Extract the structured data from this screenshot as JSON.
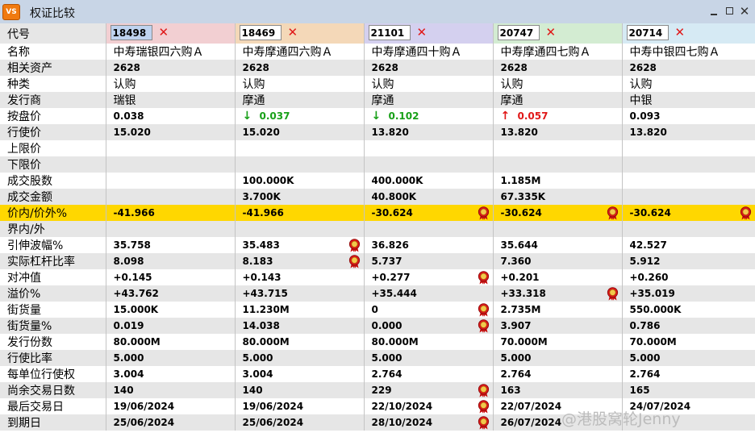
{
  "window": {
    "icon_text": "VS",
    "title": "权证比较",
    "minimize_icon": "minimize-icon",
    "maximize_icon": "maximize-icon",
    "close_icon": "close-icon",
    "close_glyph": "✕"
  },
  "colors": {
    "highlight_row": "#ffd700",
    "up": "#e01818",
    "down": "#18a018",
    "remove": "#e01818",
    "column_headers": [
      "#f2cfd2",
      "#f4d8b8",
      "#d4d0ef",
      "#d3ecd2",
      "#d6eaf4"
    ]
  },
  "header": {
    "code_label": "代号",
    "remove_glyph": "✕",
    "codes": [
      "18498",
      "18469",
      "21101",
      "20747",
      "20714"
    ]
  },
  "rows": [
    {
      "label": "名称",
      "type": "cjk",
      "cells": [
        {
          "v": "中寿瑞银四六购Ａ"
        },
        {
          "v": "中寿摩通四六购Ａ"
        },
        {
          "v": "中寿摩通四十购Ａ"
        },
        {
          "v": "中寿摩通四七购Ａ"
        },
        {
          "v": "中寿中银四七购Ａ"
        }
      ]
    },
    {
      "label": "相关资产",
      "type": "num",
      "cells": [
        {
          "v": "2628"
        },
        {
          "v": "2628"
        },
        {
          "v": "2628"
        },
        {
          "v": "2628"
        },
        {
          "v": "2628"
        }
      ]
    },
    {
      "label": "种类",
      "type": "cjk",
      "cells": [
        {
          "v": "认购"
        },
        {
          "v": "认购"
        },
        {
          "v": "认购"
        },
        {
          "v": "认购"
        },
        {
          "v": "认购"
        }
      ]
    },
    {
      "label": "发行商",
      "type": "cjk",
      "cells": [
        {
          "v": "瑞银"
        },
        {
          "v": "摩通"
        },
        {
          "v": "摩通"
        },
        {
          "v": "摩通"
        },
        {
          "v": "中银"
        }
      ]
    },
    {
      "label": "按盘价",
      "type": "num",
      "cells": [
        {
          "v": "0.038"
        },
        {
          "v": "0.037",
          "dir": "down"
        },
        {
          "v": "0.102",
          "dir": "down"
        },
        {
          "v": "0.057",
          "dir": "up"
        },
        {
          "v": "0.093"
        }
      ]
    },
    {
      "label": "行使价",
      "type": "num",
      "cells": [
        {
          "v": "15.020"
        },
        {
          "v": "15.020"
        },
        {
          "v": "13.820"
        },
        {
          "v": "13.820"
        },
        {
          "v": "13.820"
        }
      ]
    },
    {
      "label": "上限价",
      "type": "num",
      "cells": [
        {
          "v": ""
        },
        {
          "v": ""
        },
        {
          "v": ""
        },
        {
          "v": ""
        },
        {
          "v": ""
        }
      ]
    },
    {
      "label": "下限价",
      "type": "num",
      "cells": [
        {
          "v": ""
        },
        {
          "v": ""
        },
        {
          "v": ""
        },
        {
          "v": ""
        },
        {
          "v": ""
        }
      ]
    },
    {
      "label": "成交股数",
      "type": "num",
      "cells": [
        {
          "v": ""
        },
        {
          "v": "100.000K"
        },
        {
          "v": "400.000K"
        },
        {
          "v": "1.185M"
        },
        {
          "v": ""
        }
      ]
    },
    {
      "label": "成交金额",
      "type": "num",
      "cells": [
        {
          "v": ""
        },
        {
          "v": "3.700K"
        },
        {
          "v": "40.800K"
        },
        {
          "v": "67.335K"
        },
        {
          "v": ""
        }
      ]
    },
    {
      "label": "价内/价外%",
      "type": "num",
      "highlight": true,
      "cells": [
        {
          "v": "-41.966"
        },
        {
          "v": "-41.966"
        },
        {
          "v": "-30.624",
          "best": true
        },
        {
          "v": "-30.624",
          "best": true
        },
        {
          "v": "-30.624",
          "best": true
        }
      ]
    },
    {
      "label": "界内/外",
      "type": "num",
      "cells": [
        {
          "v": ""
        },
        {
          "v": ""
        },
        {
          "v": ""
        },
        {
          "v": ""
        },
        {
          "v": ""
        }
      ]
    },
    {
      "label": "引伸波幅%",
      "type": "num",
      "cells": [
        {
          "v": "35.758"
        },
        {
          "v": "35.483",
          "best": true
        },
        {
          "v": "36.826"
        },
        {
          "v": "35.644"
        },
        {
          "v": "42.527"
        }
      ]
    },
    {
      "label": "实际杠杆比率",
      "type": "num",
      "cells": [
        {
          "v": "8.098"
        },
        {
          "v": "8.183",
          "best": true
        },
        {
          "v": "5.737"
        },
        {
          "v": "7.360"
        },
        {
          "v": "5.912"
        }
      ]
    },
    {
      "label": "对冲值",
      "type": "num",
      "cells": [
        {
          "v": "+0.145"
        },
        {
          "v": "+0.143"
        },
        {
          "v": "+0.277",
          "best": true
        },
        {
          "v": "+0.201"
        },
        {
          "v": "+0.260"
        }
      ]
    },
    {
      "label": "溢价%",
      "type": "num",
      "cells": [
        {
          "v": "+43.762"
        },
        {
          "v": "+43.715"
        },
        {
          "v": "+35.444"
        },
        {
          "v": "+33.318",
          "best": true
        },
        {
          "v": "+35.019"
        }
      ]
    },
    {
      "label": "街货量",
      "type": "num",
      "cells": [
        {
          "v": "15.000K"
        },
        {
          "v": "11.230M"
        },
        {
          "v": "0",
          "best": true
        },
        {
          "v": "2.735M"
        },
        {
          "v": "550.000K"
        }
      ]
    },
    {
      "label": "街货量%",
      "type": "num",
      "cells": [
        {
          "v": "0.019"
        },
        {
          "v": "14.038"
        },
        {
          "v": "0.000",
          "best": true
        },
        {
          "v": "3.907"
        },
        {
          "v": "0.786"
        }
      ]
    },
    {
      "label": "发行份数",
      "type": "num",
      "cells": [
        {
          "v": "80.000M"
        },
        {
          "v": "80.000M"
        },
        {
          "v": "80.000M"
        },
        {
          "v": "70.000M"
        },
        {
          "v": "70.000M"
        }
      ]
    },
    {
      "label": "行使比率",
      "type": "num",
      "cells": [
        {
          "v": "5.000"
        },
        {
          "v": "5.000"
        },
        {
          "v": "5.000"
        },
        {
          "v": "5.000"
        },
        {
          "v": "5.000"
        }
      ]
    },
    {
      "label": "每单位行使权",
      "type": "num",
      "cells": [
        {
          "v": "3.004"
        },
        {
          "v": "3.004"
        },
        {
          "v": "2.764"
        },
        {
          "v": "2.764"
        },
        {
          "v": "2.764"
        }
      ]
    },
    {
      "label": "尚余交易日数",
      "type": "num",
      "cells": [
        {
          "v": "140"
        },
        {
          "v": "140"
        },
        {
          "v": "229",
          "best": true
        },
        {
          "v": "163"
        },
        {
          "v": "165"
        }
      ]
    },
    {
      "label": "最后交易日",
      "type": "num",
      "cells": [
        {
          "v": "19/06/2024"
        },
        {
          "v": "19/06/2024"
        },
        {
          "v": "22/10/2024",
          "best": true
        },
        {
          "v": "22/07/2024"
        },
        {
          "v": "24/07/2024"
        }
      ]
    },
    {
      "label": "到期日",
      "type": "num",
      "cells": [
        {
          "v": "25/06/2024"
        },
        {
          "v": "25/06/2024"
        },
        {
          "v": "28/10/2024",
          "best": true
        },
        {
          "v": "26/07/2024"
        },
        {
          "v": ""
        }
      ]
    }
  ],
  "icons": {
    "best_value": "award-ribbon-icon",
    "price_down": "down-arrow-icon",
    "price_up": "up-arrow-icon",
    "remove": "remove-x-icon"
  },
  "watermark": "@港股窝轮Jenny"
}
